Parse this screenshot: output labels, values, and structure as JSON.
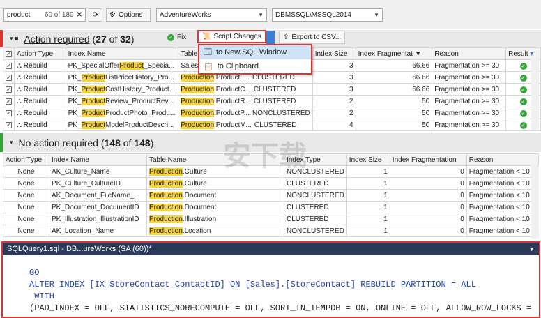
{
  "toolbar": {
    "search_value": "product",
    "search_count": "60 of 180",
    "options_label": "Options",
    "database": "AdventureWorks",
    "server": "DBMSSQL\\MSSQL2014"
  },
  "section1": {
    "title": "Action required",
    "count": "27",
    "total": "32",
    "fix_label": "Fix",
    "script_label": "Script Changes",
    "export_label": "Export to CSV..."
  },
  "menu": {
    "items": [
      "to New SQL Window",
      "to Clipboard"
    ]
  },
  "grid1": {
    "headers": [
      "Action Type",
      "Index Name",
      "Table",
      "Index Size",
      "Index Fragmentat",
      "Reason",
      "Result"
    ],
    "rows": [
      {
        "action": "Rebuild",
        "pre": "PK_SpecialOffer",
        "hl": "Product",
        "post": "_Specia...",
        "table_hl": "",
        "table": "Sales",
        "type": "",
        "size": "3",
        "frag": "66.66",
        "reason": "Fragmentation >= 30"
      },
      {
        "action": "Rebuild",
        "pre": "PK_",
        "hl": "Product",
        "post": "ListPriceHistory_Pro...",
        "table_hl": "Production",
        "table": ".ProductL...",
        "type": "CLUSTERED",
        "size": "3",
        "frag": "66.66",
        "reason": "Fragmentation >= 30"
      },
      {
        "action": "Rebuild",
        "pre": "PK_",
        "hl": "Product",
        "post": "CostHistory_Product...",
        "table_hl": "Production",
        "table": ".ProductC...",
        "type": "CLUSTERED",
        "size": "3",
        "frag": "66.66",
        "reason": "Fragmentation >= 30"
      },
      {
        "action": "Rebuild",
        "pre": "PK_",
        "hl": "Product",
        "post": "Review_ProductRev...",
        "table_hl": "Production",
        "table": ".ProductR...",
        "type": "CLUSTERED",
        "size": "2",
        "frag": "50",
        "reason": "Fragmentation >= 30"
      },
      {
        "action": "Rebuild",
        "pre": "PK_",
        "hl": "Product",
        "post": "ProductPhoto_Produ...",
        "table_hl": "Production",
        "table": ".ProductP...",
        "type": "NONCLUSTERED",
        "size": "2",
        "frag": "50",
        "reason": "Fragmentation >= 30"
      },
      {
        "action": "Rebuild",
        "pre": "PK_",
        "hl": "Product",
        "post": "ModelProductDescri...",
        "table_hl": "Production",
        "table": ".ProductM...",
        "type": "CLUSTERED",
        "size": "4",
        "frag": "50",
        "reason": "Fragmentation >= 30"
      }
    ]
  },
  "section2": {
    "title": "No action required",
    "count": "148",
    "total": "148"
  },
  "grid2": {
    "headers": [
      "Action Type",
      "Index Name",
      "Table Name",
      "Index Type",
      "Index Size",
      "Index Fragmentation",
      "Reason"
    ],
    "rows": [
      {
        "action": "None",
        "name": "AK_Culture_Name",
        "table_hl": "Production",
        "table": ".Culture",
        "type": "NONCLUSTERED",
        "size": "1",
        "frag": "0",
        "reason": "Fragmentation < 10"
      },
      {
        "action": "None",
        "name": "PK_Culture_CultureID",
        "table_hl": "Production",
        "table": ".Culture",
        "type": "CLUSTERED",
        "size": "1",
        "frag": "0",
        "reason": "Fragmentation < 10"
      },
      {
        "action": "None",
        "name": "AK_Document_FileName_...",
        "table_hl": "Production",
        "table": ".Document",
        "type": "NONCLUSTERED",
        "size": "1",
        "frag": "0",
        "reason": "Fragmentation < 10"
      },
      {
        "action": "None",
        "name": "PK_Document_DocumentID",
        "table_hl": "Production",
        "table": ".Document",
        "type": "CLUSTERED",
        "size": "1",
        "frag": "0",
        "reason": "Fragmentation < 10"
      },
      {
        "action": "None",
        "name": "PK_Illustration_IllustrationID",
        "table_hl": "Production",
        "table": ".Illustration",
        "type": "CLUSTERED",
        "size": "1",
        "frag": "0",
        "reason": "Fragmentation < 10"
      },
      {
        "action": "None",
        "name": "AK_Location_Name",
        "table_hl": "Production",
        "table": ".Location",
        "type": "NONCLUSTERED",
        "size": "1",
        "frag": "0",
        "reason": "Fragmentation < 10"
      }
    ]
  },
  "editor": {
    "tab": "SQLQuery1.sql - DB...ureWorks (SA (60))*",
    "lines": [
      "GO",
      "",
      "ALTER INDEX [IX_StoreContact_ContactID] ON [Sales].[StoreContact] REBUILD PARTITION = ALL",
      " WITH",
      "(PAD_INDEX = OFF, STATISTICS_NORECOMPUTE = OFF, SORT_IN_TEMPDB = ON, ONLINE = OFF, ALLOW_ROW_LOCKS ="
    ]
  },
  "watermark": "安下载 anxz.com"
}
